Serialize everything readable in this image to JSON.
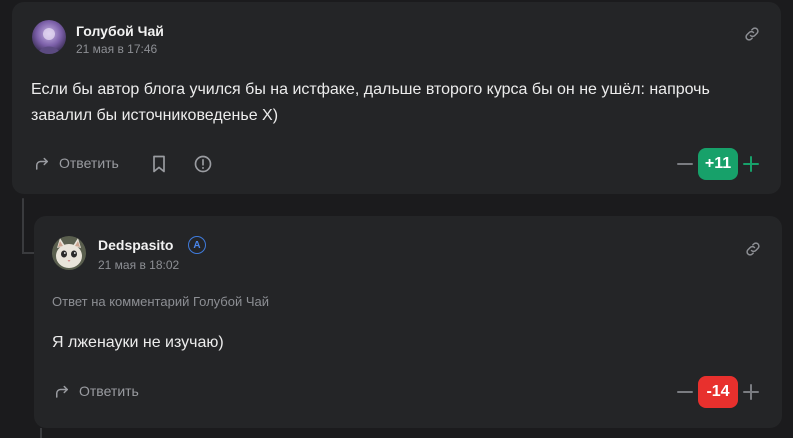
{
  "comment1": {
    "author": "Голубой Чай",
    "date": "21 мая в 17:46",
    "text": "Если бы автор блога учился бы на истфаке, дальше второго курса бы он не ушёл: напрочь завалил бы источниковеденье Х)",
    "reply_label": "Ответить",
    "score": "+11",
    "score_color": "#17a16a"
  },
  "comment2": {
    "author": "Dedspasito",
    "badge": "A",
    "date": "21 мая в 18:02",
    "reply_note": "Ответ на комментарий Голубой Чай",
    "text": "Я лженауки не изучаю)",
    "reply_label": "Ответить",
    "score": "-14",
    "score_color": "#e8302d"
  },
  "icons": {
    "link": "link-icon",
    "reply": "reply-arrow-icon",
    "bookmark": "bookmark-icon",
    "report": "report-icon",
    "minus": "minus-icon",
    "plus": "plus-icon"
  }
}
